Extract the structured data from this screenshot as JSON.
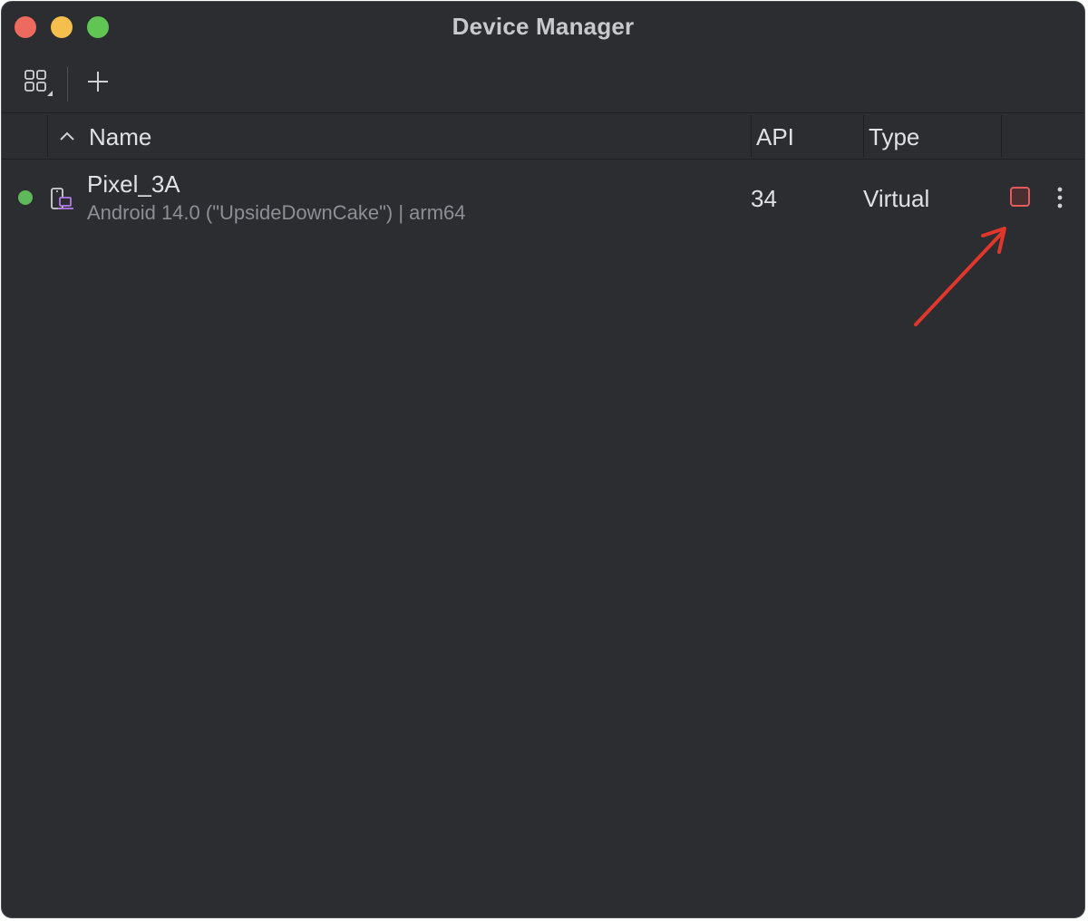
{
  "window": {
    "title": "Device Manager"
  },
  "toolbar": {
    "grid_icon": "device-grid-dropdown-icon",
    "add_icon": "plus-icon"
  },
  "table": {
    "columns": {
      "name": "Name",
      "api": "API",
      "type": "Type"
    },
    "sort": {
      "column": "Name",
      "direction": "ascending"
    },
    "rows": [
      {
        "status": "running",
        "status_color": "#5fb85a",
        "name": "Pixel_3A",
        "subtitle": "Android 14.0 (\"UpsideDownCake\") | arm64",
        "api": "34",
        "type": "Virtual",
        "stop_color": "#e55b5b"
      }
    ]
  },
  "annotation": {
    "arrow_color": "#e0362c"
  },
  "colors": {
    "background": "#2b2d30",
    "text": "#dfe1e5",
    "muted_text": "#8c8f94",
    "device_icon_accent": "#b27be8"
  }
}
